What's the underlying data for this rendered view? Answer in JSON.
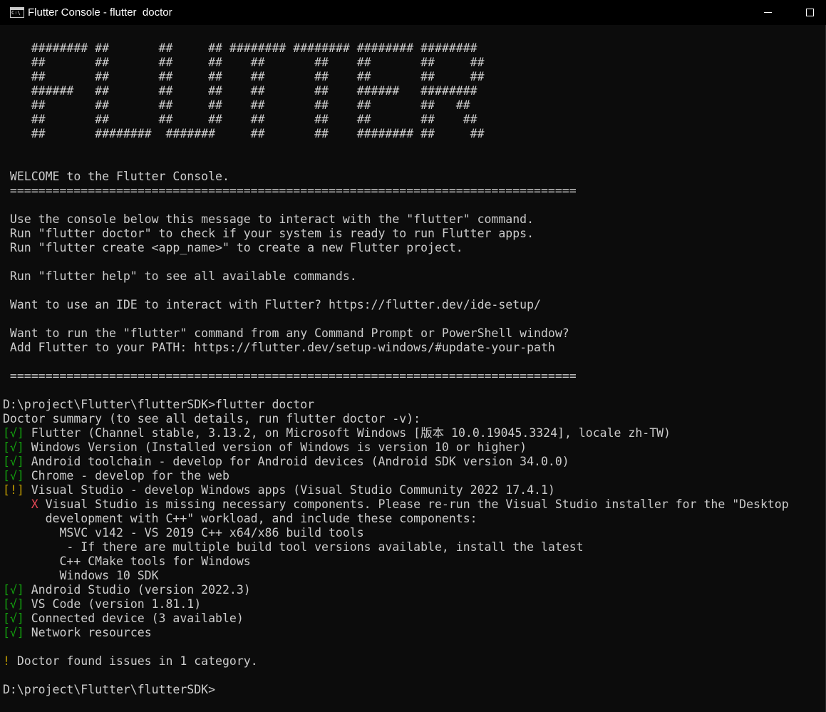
{
  "window": {
    "title": "Flutter Console - flutter  doctor",
    "icon": "console-icon",
    "icon_text": "C:\\",
    "controls": [
      "minimize",
      "maximize"
    ]
  },
  "colors": {
    "background": "#0c0c0c",
    "text": "#cccccc",
    "ok": "#13a10e",
    "warning": "#c19c00",
    "error": "#e74856"
  },
  "console": {
    "banner": [
      "    ######## ##       ##     ## ######## ######## ######## ########",
      "    ##       ##       ##     ##    ##       ##    ##       ##     ##",
      "    ##       ##       ##     ##    ##       ##    ##       ##     ##",
      "    ######   ##       ##     ##    ##       ##    ######   ########",
      "    ##       ##       ##     ##    ##       ##    ##       ##   ##",
      "    ##       ##       ##     ##    ##       ##    ##       ##    ##",
      "    ##       ########  #######     ##       ##    ######## ##     ##"
    ],
    "intro": [
      "",
      "",
      " WELCOME to the Flutter Console.",
      " ================================================================================",
      "",
      " Use the console below this message to interact with the \"flutter\" command.",
      " Run \"flutter doctor\" to check if your system is ready to run Flutter apps.",
      " Run \"flutter create <app_name>\" to create a new Flutter project.",
      "",
      " Run \"flutter help\" to see all available commands.",
      "",
      " Want to use an IDE to interact with Flutter? https://flutter.dev/ide-setup/",
      "",
      " Want to run the \"flutter\" command from any Command Prompt or PowerShell window?",
      " Add Flutter to your PATH: https://flutter.dev/setup-windows/#update-your-path",
      "",
      " ================================================================================",
      ""
    ],
    "command_line": "D:\\project\\Flutter\\flutterSDK>flutter doctor",
    "summary": "Doctor summary (to see all details, run flutter doctor -v):",
    "checks": [
      {
        "mark": "[√]",
        "status": "ok",
        "text": " Flutter (Channel stable, 3.13.2, on Microsoft Windows [版本 10.0.19045.3324], locale zh-TW)"
      },
      {
        "mark": "[√]",
        "status": "ok",
        "text": " Windows Version (Installed version of Windows is version 10 or higher)"
      },
      {
        "mark": "[√]",
        "status": "ok",
        "text": " Android toolchain - develop for Android devices (Android SDK version 34.0.0)"
      },
      {
        "mark": "[√]",
        "status": "ok",
        "text": " Chrome - develop for the web"
      },
      {
        "mark": "[!]",
        "status": "warning",
        "text": " Visual Studio - develop Windows apps (Visual Studio Community 2022 17.4.1)"
      }
    ],
    "vs_issue": {
      "indent": "    ",
      "mark": "X",
      "text": " Visual Studio is missing necessary components. Please re-run the Visual Studio installer for the \"Desktop",
      "details": [
        "      development with C++\" workload, and include these components:",
        "        MSVC v142 - VS 2019 C++ x64/x86 build tools",
        "         - If there are multiple build tool versions available, install the latest",
        "        C++ CMake tools for Windows",
        "        Windows 10 SDK"
      ]
    },
    "checks_after": [
      {
        "mark": "[√]",
        "status": "ok",
        "text": " Android Studio (version 2022.3)"
      },
      {
        "mark": "[√]",
        "status": "ok",
        "text": " VS Code (version 1.81.1)"
      },
      {
        "mark": "[√]",
        "status": "ok",
        "text": " Connected device (3 available)"
      },
      {
        "mark": "[√]",
        "status": "ok",
        "text": " Network resources"
      }
    ],
    "issues_mark": "!",
    "issues_text": " Doctor found issues in 1 category.",
    "final_prompt": "D:\\project\\Flutter\\flutterSDK>"
  }
}
